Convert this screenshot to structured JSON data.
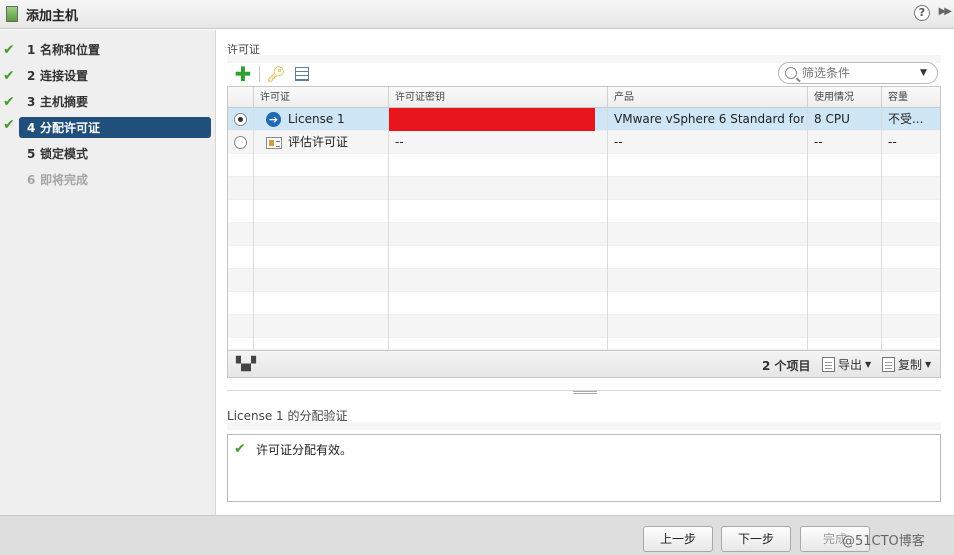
{
  "window": {
    "title": "添加主机",
    "help_label": "?",
    "expand_label": "▶▶"
  },
  "steps": [
    {
      "num": "1",
      "label": "名称和位置",
      "state": "done"
    },
    {
      "num": "2",
      "label": "连接设置",
      "state": "done"
    },
    {
      "num": "3",
      "label": "主机摘要",
      "state": "done"
    },
    {
      "num": "4",
      "label": "分配许可证",
      "state": "active"
    },
    {
      "num": "5",
      "label": "锁定模式",
      "state": "pending"
    },
    {
      "num": "6",
      "label": "即将完成",
      "state": "disabled"
    }
  ],
  "license_section": {
    "title": "许可证"
  },
  "filter": {
    "placeholder": "筛选条件"
  },
  "table": {
    "headers": [
      "许可证",
      "许可证密钥",
      "产品",
      "使用情况",
      "容量"
    ],
    "rows": [
      {
        "selected": true,
        "icon": "license-arrow-icon",
        "name": "License 1",
        "key": "",
        "product": "VMware vSphere 6 Standard for ...",
        "usage": "8 CPU",
        "capacity": "不受..."
      },
      {
        "selected": false,
        "icon": "evaluation-license-icon",
        "name": "评估许可证",
        "key": "--",
        "product": "--",
        "usage": "--",
        "capacity": "--"
      }
    ],
    "item_count": "2 个项目",
    "export_label": "导出",
    "copy_label": "复制"
  },
  "validation": {
    "title": "License 1 的分配验证",
    "message": "许可证分配有效。"
  },
  "buttons": {
    "back": "上一步",
    "next": "下一步",
    "finish": "完成"
  },
  "watermark": "@51CTO博客",
  "colors": {
    "accent": "#1f4f7a",
    "check": "#4a9a2c",
    "selected_row": "#cfe6f7",
    "redaction": "#e8151c"
  }
}
